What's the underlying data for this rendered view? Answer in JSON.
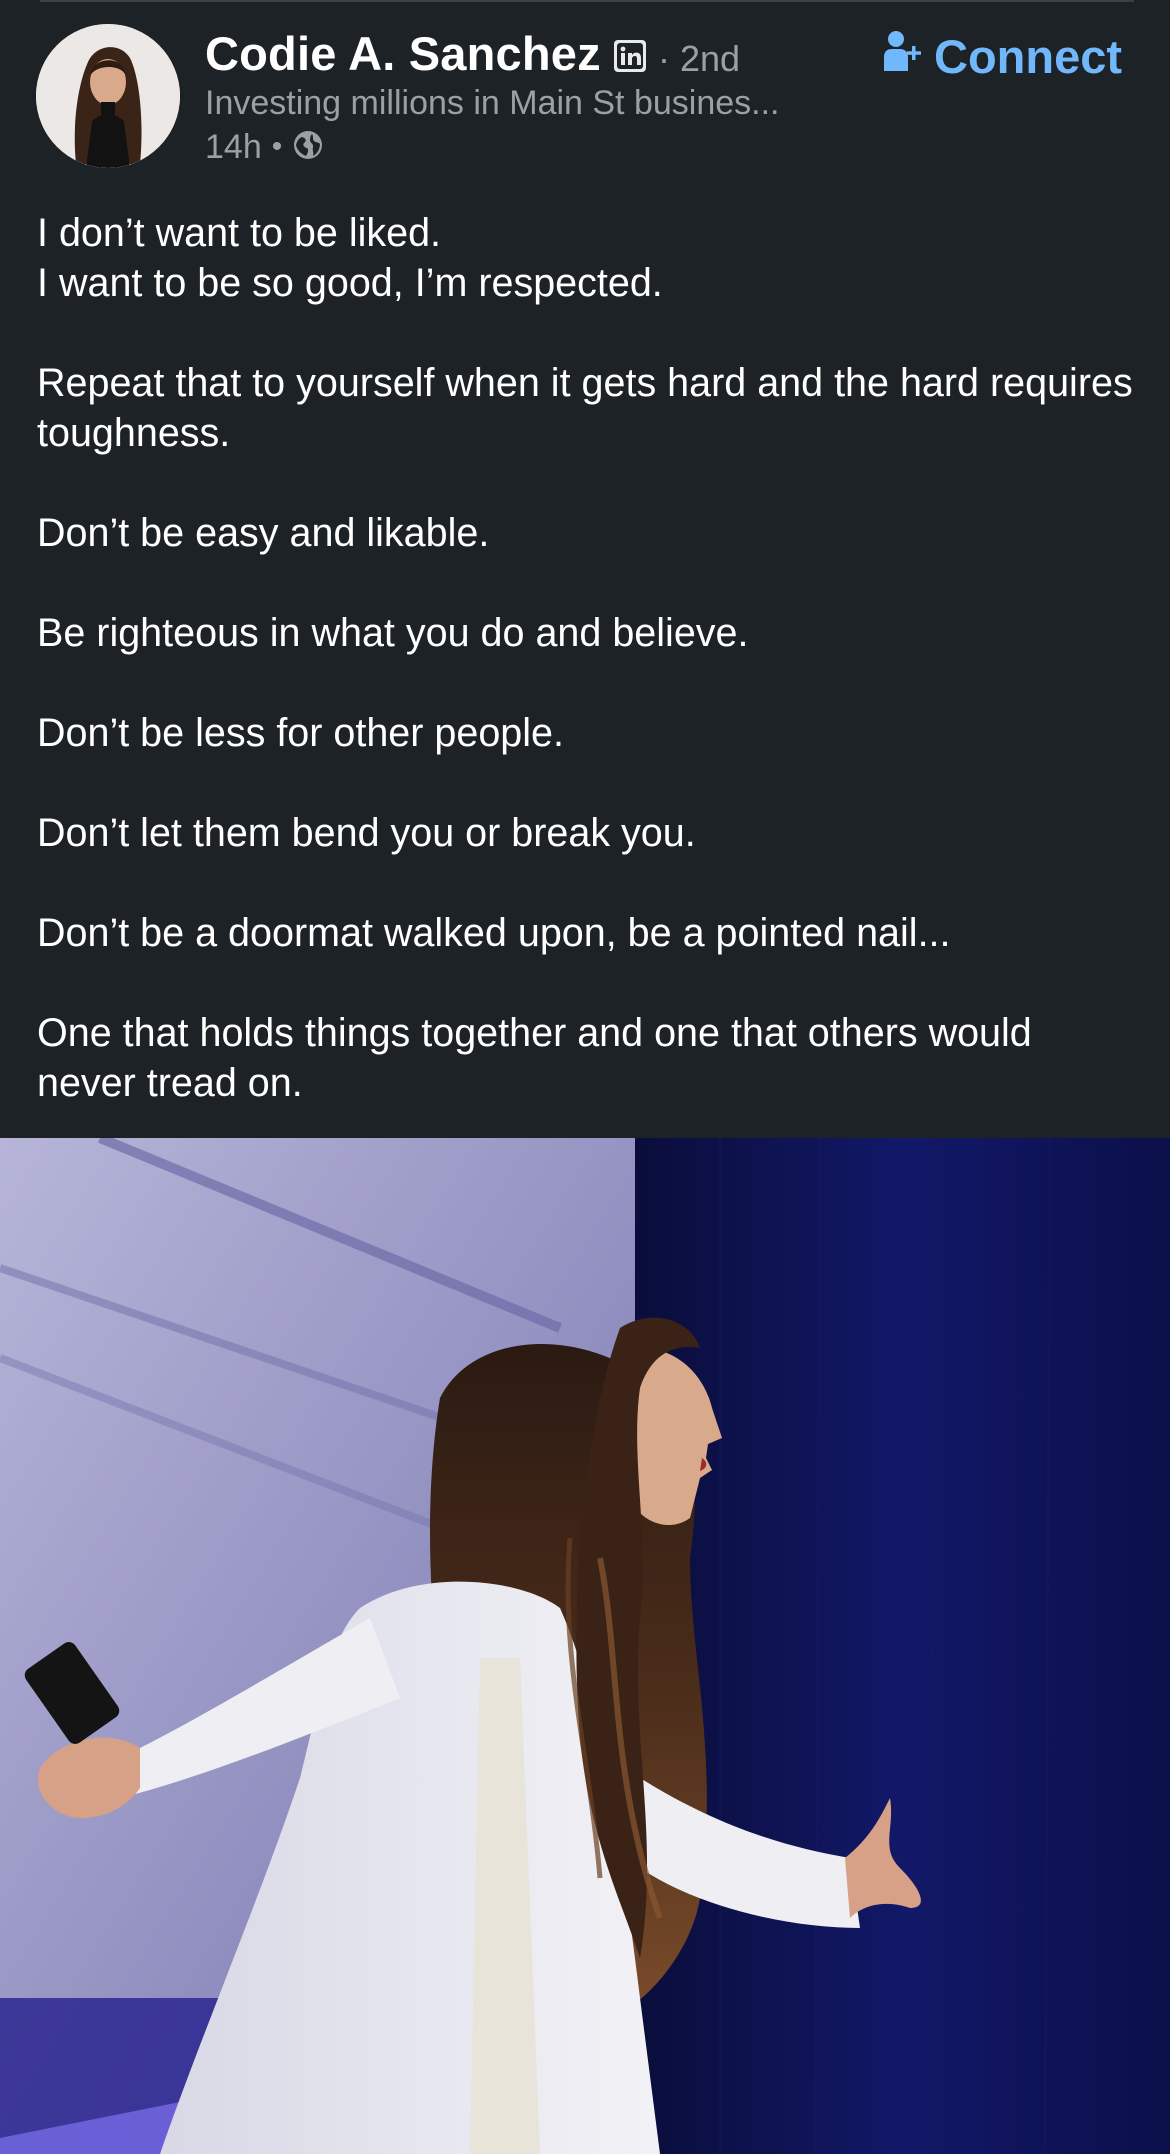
{
  "author": {
    "name": "Codie A. Sanchez",
    "degree": "· 2nd",
    "headline": "Investing millions in Main St busines...",
    "timestamp": "14h",
    "separator": "•"
  },
  "connect": {
    "label": "Connect"
  },
  "icons": {
    "linkedin_badge": "linkedin-icon",
    "visibility": "globe-icon",
    "connect": "add-person-icon"
  },
  "colors": {
    "background": "#1d2226",
    "text_primary": "#ffffff",
    "text_secondary": "#9aa1a6",
    "accent": "#71b7fb"
  },
  "post": {
    "paragraphs": [
      "I don’t want to be liked.\nI want to be so good, I’m respected.",
      "Repeat that to yourself when it gets hard and the hard requires toughness.",
      "Don’t be easy and likable.",
      "Be righteous in what you do and believe.",
      "Don’t be less for other people.",
      "Don’t let them bend you or break you.",
      "Don’t be a doormat walked upon, be a pointed nail...",
      "One that holds things together and one that others would never tread on."
    ]
  }
}
